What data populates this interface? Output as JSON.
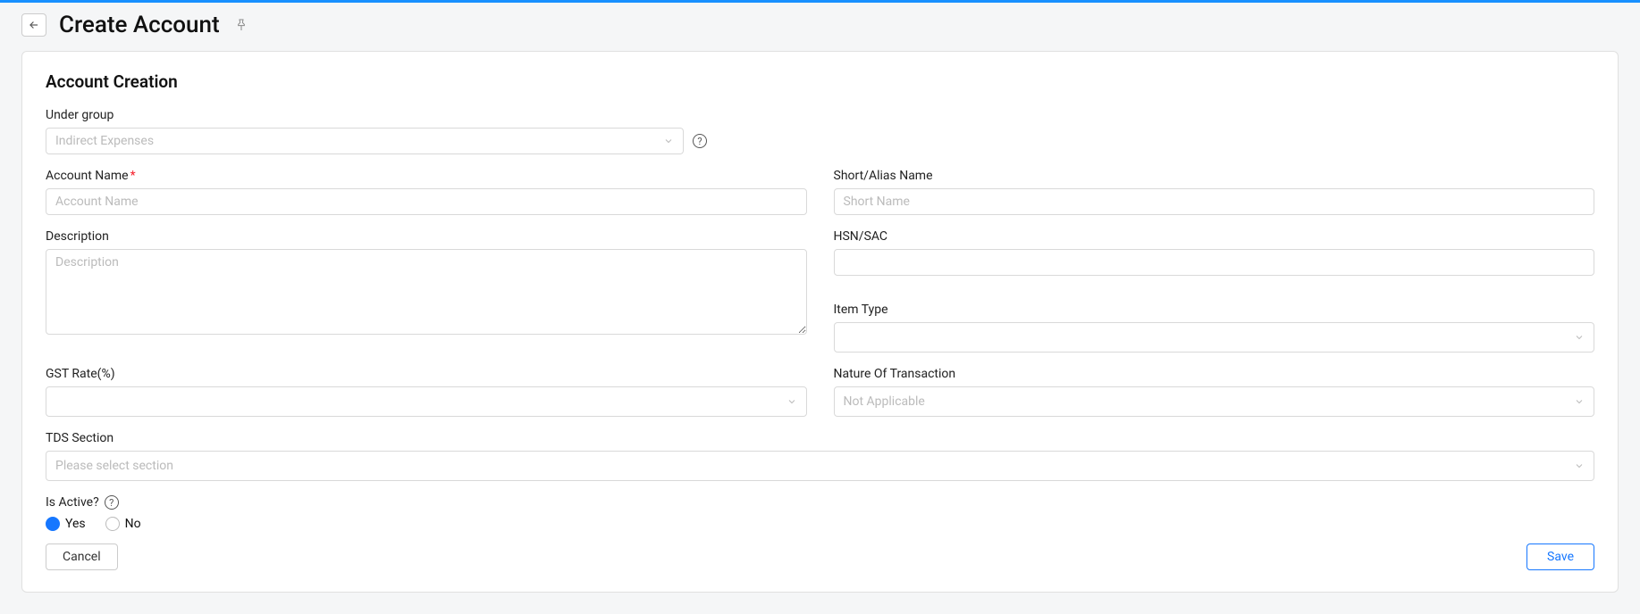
{
  "header": {
    "title": "Create Account"
  },
  "card": {
    "title": "Account Creation"
  },
  "fields": {
    "under_group": {
      "label": "Under group",
      "value": "Indirect Expenses"
    },
    "account_name": {
      "label": "Account Name",
      "placeholder": "Account Name"
    },
    "short_alias": {
      "label": "Short/Alias Name",
      "placeholder": "Short Name"
    },
    "description": {
      "label": "Description",
      "placeholder": "Description"
    },
    "hsn_sac": {
      "label": "HSN/SAC"
    },
    "item_type": {
      "label": "Item Type"
    },
    "gst_rate": {
      "label": "GST Rate(%)"
    },
    "nature_of_transaction": {
      "label": "Nature Of Transaction",
      "value": "Not Applicable"
    },
    "tds_section": {
      "label": "TDS Section",
      "placeholder": "Please select section"
    },
    "is_active": {
      "label": "Is Active?",
      "yes": "Yes",
      "no": "No"
    }
  },
  "buttons": {
    "cancel": "Cancel",
    "save": "Save"
  },
  "symbols": {
    "required": "*",
    "help": "?"
  }
}
